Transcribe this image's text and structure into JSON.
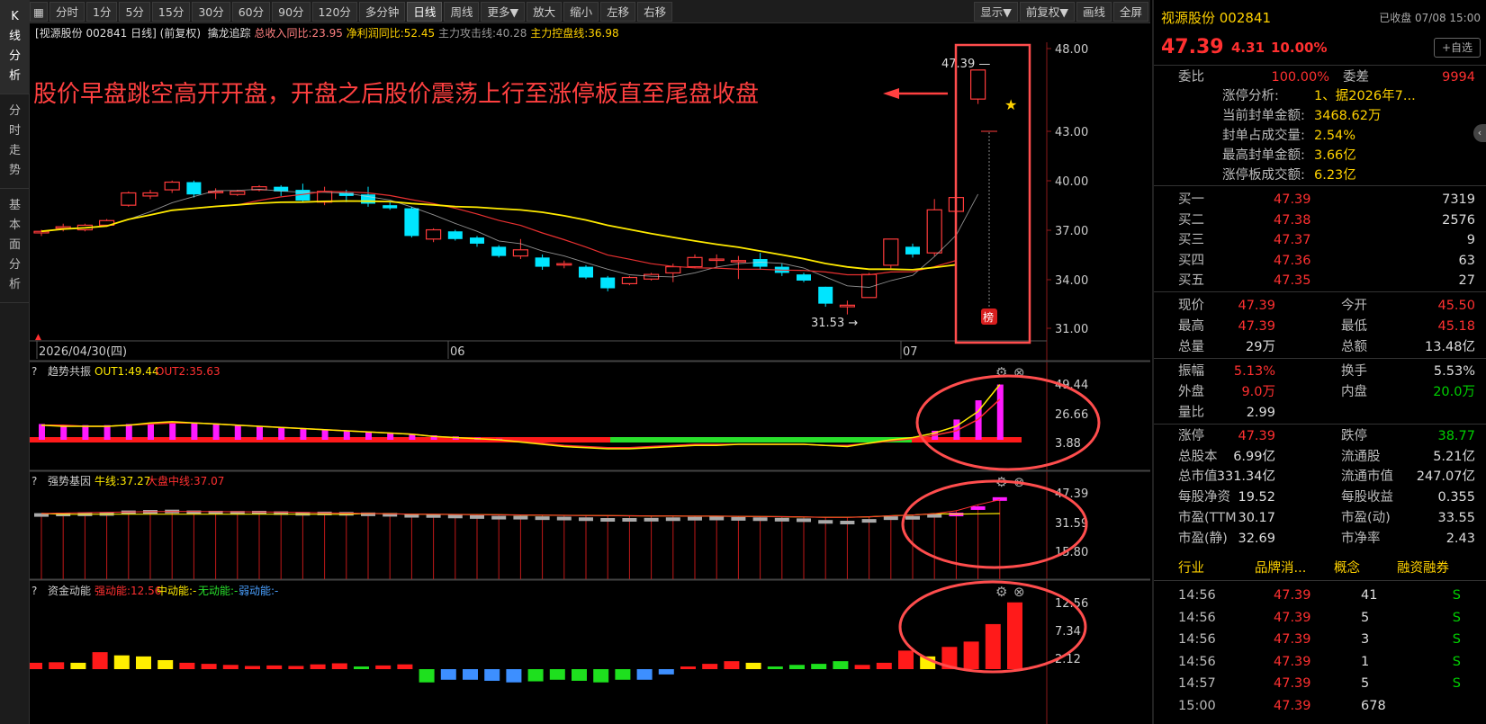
{
  "sidebar": {
    "items": [
      "K线分析",
      "分时走势",
      "基本面分析"
    ]
  },
  "toolbar": {
    "left": [
      "分时",
      "1分",
      "5分",
      "15分",
      "30分",
      "60分",
      "90分",
      "120分",
      "多分钟",
      "日线",
      "周线",
      "更多▼",
      "放大",
      "缩小",
      "左移",
      "右移"
    ],
    "active": "日线",
    "right": [
      "显示▼",
      "前复权▼",
      "画线",
      "全屏"
    ]
  },
  "titlebar": {
    "stock": "[视源股份 002841 日线]",
    "adjust": "(前复权)",
    "indicator": "擒龙追踪",
    "rev": "总收入同比:23.95",
    "profit": "净利润同比:52.45",
    "attack": "主力攻击线:40.28",
    "control": "主力控盘线:36.98"
  },
  "annotation": "股价早盘跳空高开开盘，开盘之后股价震荡上行至涨停板直至尾盘收盘",
  "main_chart": {
    "y_ticks": [
      "48.00",
      "43.00",
      "40.00",
      "37.00",
      "34.00",
      "31.00"
    ],
    "x_labels": [
      "2026/04/30(四)",
      "06",
      "07"
    ],
    "high_label": "47.39",
    "low_label": "31.53",
    "badge": "榜"
  },
  "panel1": {
    "name": "趋势共振",
    "out1": "OUT1:49.44",
    "out2": "OUT2:35.63",
    "ticks": [
      "49.44",
      "26.66",
      "3.88"
    ]
  },
  "panel2": {
    "name": "强势基因",
    "niu": "牛线:37.27",
    "dapan": "大盘中线:37.07",
    "ticks": [
      "47.39",
      "31.59",
      "15.80"
    ]
  },
  "panel3": {
    "name": "资金动能",
    "strong": "强动能:12.56",
    "mid": "中动能:-",
    "none": "无动能:-",
    "weak": "弱动能:-",
    "ticks": [
      "12.56",
      "7.34",
      "2.12"
    ]
  },
  "chart_data": {
    "type": "candlestick",
    "candles": [
      [
        36.8,
        36.9,
        37.0,
        36.6
      ],
      [
        37.1,
        37.2,
        37.4,
        36.9
      ],
      [
        37.0,
        37.3,
        37.4,
        36.9
      ],
      [
        37.3,
        37.6,
        37.7,
        37.2
      ],
      [
        38.6,
        39.4,
        39.5,
        38.5
      ],
      [
        39.2,
        39.4,
        39.6,
        39.0
      ],
      [
        39.6,
        40.1,
        40.2,
        39.4
      ],
      [
        40.1,
        39.3,
        40.2,
        39.1
      ],
      [
        39.5,
        39.5,
        39.7,
        39.0
      ],
      [
        39.3,
        39.5,
        39.6,
        39.2
      ],
      [
        39.6,
        39.8,
        39.9,
        39.5
      ],
      [
        39.8,
        39.5,
        39.9,
        39.2
      ],
      [
        39.6,
        38.9,
        40.0,
        38.8
      ],
      [
        38.8,
        39.5,
        39.8,
        38.6
      ],
      [
        39.4,
        39.2,
        39.6,
        38.8
      ],
      [
        39.3,
        38.7,
        39.8,
        38.5
      ],
      [
        38.6,
        38.4,
        38.8,
        38.3
      ],
      [
        38.4,
        36.6,
        38.5,
        36.5
      ],
      [
        36.4,
        37.0,
        37.1,
        36.2
      ],
      [
        36.9,
        36.4,
        37.0,
        36.3
      ],
      [
        36.5,
        36.1,
        36.6,
        35.9
      ],
      [
        35.9,
        35.3,
        36.0,
        35.2
      ],
      [
        35.3,
        35.7,
        36.4,
        35.1
      ],
      [
        35.2,
        34.6,
        35.4,
        34.4
      ],
      [
        34.8,
        34.8,
        35.0,
        34.5
      ],
      [
        34.6,
        33.9,
        34.7,
        33.8
      ],
      [
        33.9,
        33.2,
        34.0,
        33.0
      ],
      [
        33.5,
        33.9,
        34.0,
        33.4
      ],
      [
        33.8,
        34.1,
        34.2,
        33.7
      ],
      [
        34.2,
        34.6,
        34.8,
        33.6
      ],
      [
        34.6,
        35.2,
        35.4,
        34.5
      ],
      [
        35.1,
        35.1,
        35.4,
        34.6
      ],
      [
        35.0,
        35.0,
        35.3,
        33.8
      ],
      [
        35.1,
        34.6,
        35.5,
        34.4
      ],
      [
        34.6,
        34.2,
        34.8,
        34.0
      ],
      [
        34.1,
        33.7,
        34.2,
        33.6
      ],
      [
        33.3,
        32.2,
        33.3,
        32.0
      ],
      [
        32.0,
        32.1,
        32.4,
        31.5
      ],
      [
        32.6,
        34.1,
        34.2,
        32.6
      ],
      [
        34.7,
        36.4,
        36.4,
        34.5
      ],
      [
        35.9,
        35.4,
        36.1,
        35.2
      ],
      [
        35.5,
        38.3,
        39.0,
        35.3
      ],
      [
        38.2,
        39.1,
        40.3,
        36.5
      ],
      [
        45.5,
        47.39,
        47.39,
        45.18
      ]
    ]
  },
  "panel1_data": {
    "bars": [
      14,
      13,
      13,
      13,
      14,
      15,
      16,
      15,
      14,
      13,
      12,
      11,
      10,
      9,
      8,
      7,
      6,
      5,
      4,
      3,
      2,
      1,
      0,
      0,
      0,
      0,
      0,
      0,
      0,
      0,
      0,
      0,
      0,
      0,
      0,
      0,
      0,
      0,
      0,
      0,
      0,
      8,
      18,
      35,
      49
    ],
    "out1": [
      13,
      12,
      12,
      12,
      13,
      15,
      16,
      15,
      14,
      13,
      12,
      11,
      10,
      9,
      8,
      7,
      6,
      5,
      3,
      2,
      1,
      0,
      -2,
      -4,
      -6,
      -7,
      -8,
      -8,
      -7,
      -6,
      -5,
      -5,
      -4,
      -4,
      -4,
      -4,
      -5,
      -6,
      -3,
      0,
      2,
      6,
      12,
      25,
      49
    ],
    "out2": [
      13,
      13,
      12,
      12,
      13,
      14,
      15,
      15,
      14,
      13,
      12,
      11,
      10,
      9,
      8,
      7,
      6,
      5,
      3,
      2,
      1,
      0,
      -1,
      -3,
      -5,
      -6,
      -7,
      -7,
      -6,
      -5,
      -4,
      -4,
      -4,
      -4,
      -4,
      -4,
      -5,
      -5,
      -3,
      -1,
      1,
      4,
      8,
      18,
      36
    ]
  },
  "panel2_data": {
    "ma": [
      37.8,
      38.0,
      38.3,
      38.5,
      38.7,
      38.9,
      39.0,
      39.0,
      38.9,
      38.8,
      38.7,
      38.6,
      38.4,
      38.2,
      38.0,
      37.8,
      37.6,
      37.4,
      37.3,
      37.2,
      37.1,
      37.0,
      36.9,
      36.8,
      36.7,
      36.6,
      36.5,
      36.4,
      36.3,
      36.3,
      36.2,
      36.2,
      36.1,
      36.0,
      35.9,
      35.7,
      35.5,
      35.5,
      35.8,
      36.4,
      36.9,
      37.7,
      39.4,
      43.0,
      46.0
    ],
    "gray": [
      36.9,
      37.2,
      37.3,
      37.5,
      38.5,
      38.8,
      39.0,
      38.5,
      38.3,
      38.2,
      38.3,
      38.0,
      37.6,
      37.8,
      37.6,
      37.3,
      37.0,
      36.4,
      36.3,
      36.0,
      35.7,
      35.3,
      35.3,
      35.0,
      34.8,
      34.4,
      34.0,
      34.0,
      34.1,
      34.4,
      34.7,
      34.8,
      34.6,
      34.4,
      34.1,
      33.8,
      32.8,
      32.4,
      33.4,
      35.0,
      35.2,
      36.4,
      37.2,
      41.0,
      46.4
    ]
  },
  "panel3_data": {
    "values": [
      1.2,
      1.3,
      1.2,
      3.2,
      2.6,
      2.4,
      1.7,
      1.2,
      1.0,
      0.8,
      0.6,
      0.7,
      0.6,
      0.9,
      1.1,
      0.5,
      0.7,
      0.9,
      -2.5,
      -2.0,
      -2.0,
      -2.2,
      -2.5,
      -2.3,
      -2.0,
      -2.2,
      -2.5,
      -2.0,
      -2.0,
      -1.0,
      0.5,
      1.0,
      1.5,
      1.2,
      0.5,
      0.8,
      1.0,
      1.5,
      0.8,
      1.2,
      3.5,
      2.4,
      4.2,
      5.2,
      8.5,
      12.6
    ],
    "colors": [
      "r",
      "r",
      "y",
      "r",
      "y",
      "y",
      "y",
      "r",
      "r",
      "r",
      "r",
      "r",
      "r",
      "r",
      "r",
      "g",
      "r",
      "r",
      "g",
      "b",
      "b",
      "b",
      "b",
      "g",
      "g",
      "g",
      "g",
      "g",
      "b",
      "b",
      "r",
      "r",
      "r",
      "y",
      "g",
      "g",
      "g",
      "g",
      "r",
      "r",
      "r",
      "y",
      "r",
      "r",
      "r",
      "r"
    ]
  },
  "info": {
    "name": "视源股份 002841",
    "status": "已收盘 07/08 15:00",
    "price": "47.39",
    "change": "4.31",
    "pct": "10.00%",
    "add": "+自选",
    "weibi_label": "委比",
    "weibi": "100.00%",
    "weicha_label": "委差",
    "weicha": "9994",
    "limit": [
      {
        "label": "涨停分析:",
        "value": "1、据2026年7..."
      },
      {
        "label": "当前封单金额:",
        "value": "3468.62万"
      },
      {
        "label": "封单占成交量:",
        "value": "2.54%"
      },
      {
        "label": "最高封单金额:",
        "value": "3.66亿"
      },
      {
        "label": "涨停板成交额:",
        "value": "6.23亿"
      }
    ],
    "bids": [
      {
        "label": "买一",
        "price": "47.39",
        "vol": "7319"
      },
      {
        "label": "买二",
        "price": "47.38",
        "vol": "2576"
      },
      {
        "label": "买三",
        "price": "47.37",
        "vol": "9"
      },
      {
        "label": "买四",
        "price": "47.36",
        "vol": "63"
      },
      {
        "label": "买五",
        "price": "47.35",
        "vol": "27"
      }
    ],
    "quote": [
      {
        "l1": "现价",
        "v1": "47.39",
        "c1": "red",
        "l2": "今开",
        "v2": "45.50",
        "c2": "red"
      },
      {
        "l1": "最高",
        "v1": "47.39",
        "c1": "red",
        "l2": "最低",
        "v2": "45.18",
        "c2": "red"
      },
      {
        "l1": "总量",
        "v1": "29万",
        "c1": "white",
        "l2": "总额",
        "v2": "13.48亿",
        "c2": "white"
      },
      {
        "l1": "振幅",
        "v1": "5.13%",
        "c1": "red",
        "l2": "换手",
        "v2": "5.53%",
        "c2": "white"
      },
      {
        "l1": "外盘",
        "v1": "9.0万",
        "c1": "red",
        "l2": "内盘",
        "v2": "20.0万",
        "c2": "green"
      },
      {
        "l1": "量比",
        "v1": "2.99",
        "c1": "white",
        "l2": "",
        "v2": "",
        "c2": "white"
      },
      {
        "l1": "涨停",
        "v1": "47.39",
        "c1": "red",
        "l2": "跌停",
        "v2": "38.77",
        "c2": "green"
      },
      {
        "l1": "总股本",
        "v1": "6.99亿",
        "c1": "white",
        "l2": "流通股",
        "v2": "5.21亿",
        "c2": "white"
      },
      {
        "l1": "总市值",
        "v1": "331.34亿",
        "c1": "white",
        "l2": "流通市值",
        "v2": "247.07亿",
        "c2": "white"
      },
      {
        "l1": "每股净资",
        "v1": "19.52",
        "c1": "white",
        "l2": "每股收益",
        "v2": "0.355",
        "c2": "white"
      },
      {
        "l1": "市盈(TTM",
        "v1": "30.17",
        "c1": "white",
        "l2": "市盈(动)",
        "v2": "33.55",
        "c2": "white"
      },
      {
        "l1": "市盈(静)",
        "v1": "32.69",
        "c1": "white",
        "l2": "市净率",
        "v2": "2.43",
        "c2": "white"
      }
    ],
    "tabs": [
      "行业",
      "品牌消...",
      "概念",
      "融资融券"
    ],
    "ticks": [
      {
        "time": "14:56",
        "price": "47.39",
        "vol": "41",
        "side": "S"
      },
      {
        "time": "14:56",
        "price": "47.39",
        "vol": "5",
        "side": "S"
      },
      {
        "time": "14:56",
        "price": "47.39",
        "vol": "3",
        "side": "S"
      },
      {
        "time": "14:56",
        "price": "47.39",
        "vol": "1",
        "side": "S"
      },
      {
        "time": "14:57",
        "price": "47.39",
        "vol": "5",
        "side": "S"
      },
      {
        "time": "15:00",
        "price": "47.39",
        "vol": "678",
        "side": ""
      }
    ]
  }
}
